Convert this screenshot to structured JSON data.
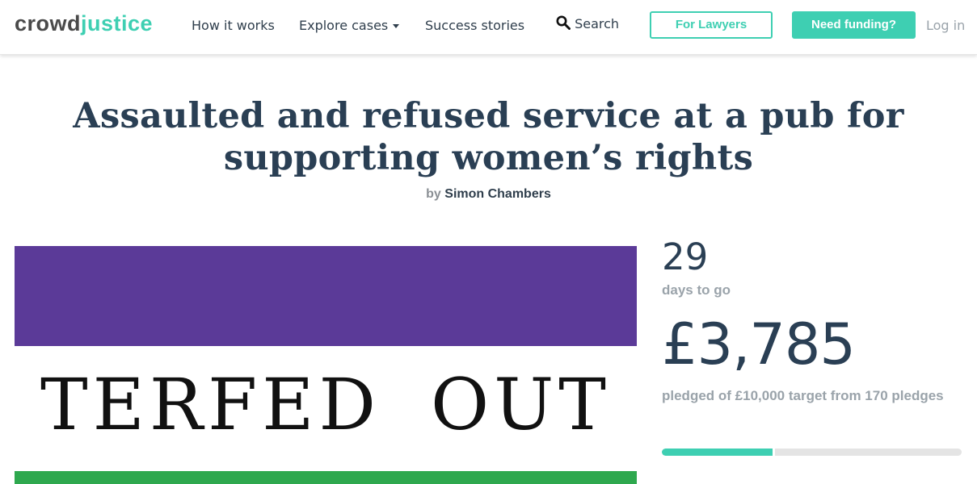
{
  "brand": {
    "logo_part1": "crowd",
    "logo_part2": "justice",
    "accent": "#3ecfb2"
  },
  "nav": {
    "how_it_works": "How it works",
    "explore_cases": "Explore cases",
    "success_stories": "Success stories",
    "search": "Search",
    "for_lawyers": "For Lawyers",
    "need_funding": "Need funding?",
    "log_in": "Log in"
  },
  "case": {
    "title": "Assaulted and refused service at a pub for supporting women’s rights",
    "by_label": "by",
    "author": "Simon Chambers",
    "hero_text": "TERFED OUT"
  },
  "stats": {
    "days_left": "29",
    "days_label": "days to go",
    "amount": "£3,785",
    "pledged_text": "pledged of £10,000 target from 170 pledges",
    "progress_fraction": 0.3785
  },
  "colors": {
    "purple": "#5b3a98",
    "green": "#2ea84e",
    "title": "#2a3f54"
  }
}
